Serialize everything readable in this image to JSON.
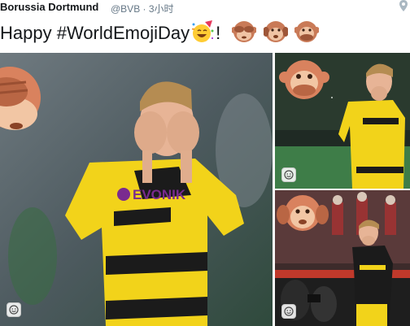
{
  "tweet": {
    "author_name": "Borussia Dortmund",
    "handle_time": "@BVB · 3小时",
    "text_main": "Happy #WorldEmojiDay",
    "text_bang": "!",
    "icons": [
      "party-face-emoji",
      "see-no-evil-monkey-emoji",
      "hear-no-evil-monkey-emoji",
      "speak-no-evil-monkey-emoji",
      "location-pin-icon"
    ]
  },
  "photos": {
    "jersey_sponsor": "EVONIK",
    "sticker_icons": [
      "see-no-evil-monkey-sticker",
      "speak-no-evil-monkey-sticker",
      "hear-no-evil-monkey-sticker"
    ],
    "badge_icon": "smiley-sticker-icon"
  },
  "colors": {
    "monkey": "#d9825e",
    "jersey_yellow": "#f2d31a",
    "jersey_black": "#1b1b1b",
    "pitch_green": "#3e7d48"
  }
}
